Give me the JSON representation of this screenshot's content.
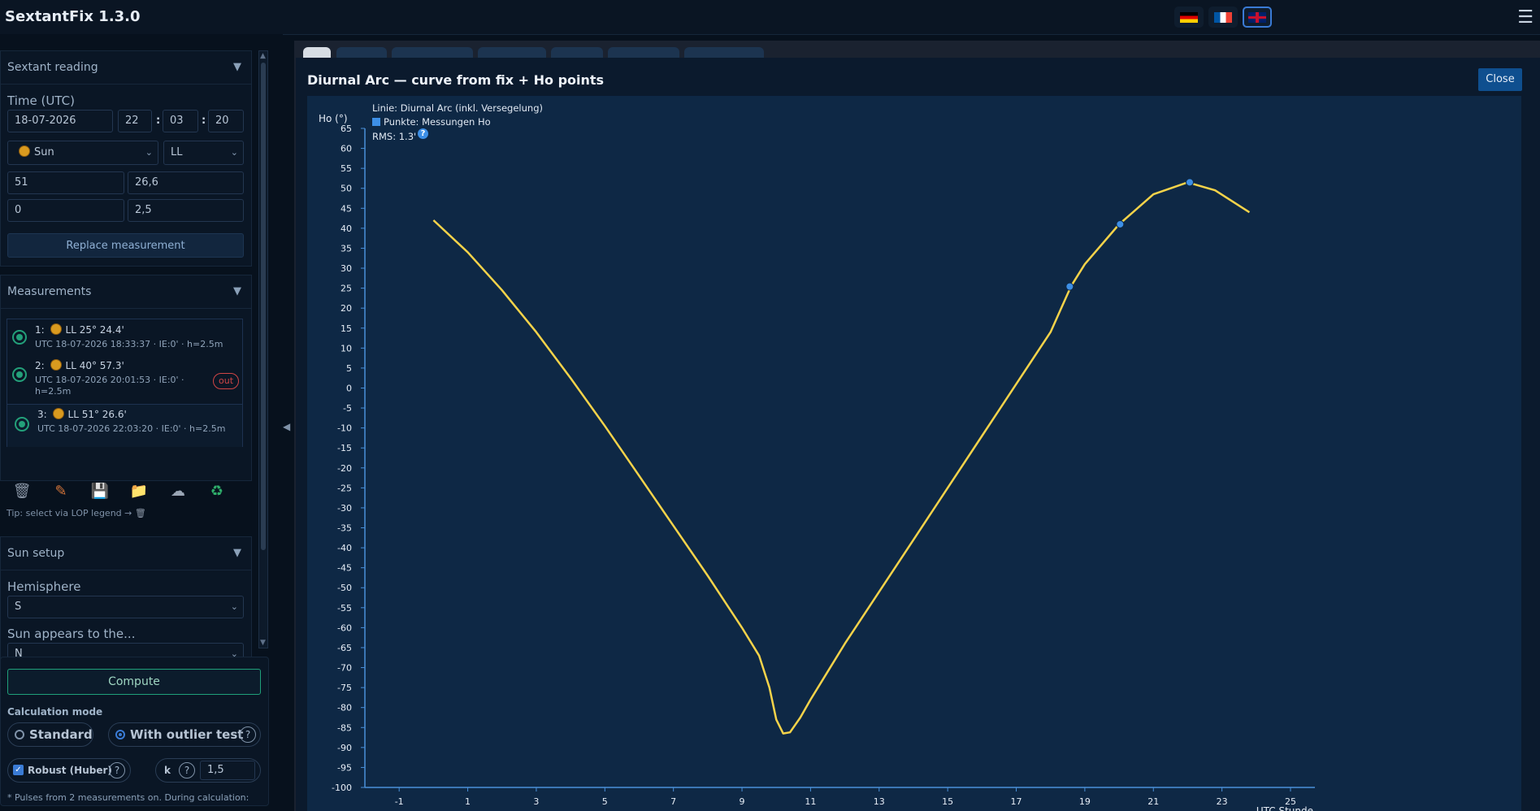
{
  "app": {
    "title": "SextantFix 1.3.0"
  },
  "languages": [
    "de",
    "fr",
    "en"
  ],
  "sextant": {
    "header": "Sextant reading",
    "time_label": "Time (UTC)",
    "date": "18-07-2026",
    "hh": "22",
    "mm": "03",
    "ss": "20",
    "body": "Sun",
    "limb": "LL",
    "deg": "51",
    "min": "26,6",
    "ie": "0",
    "height": "2,5",
    "replace_btn": "Replace measurement"
  },
  "measurements": {
    "header": "Measurements",
    "items": [
      {
        "num": "1:",
        "main": "LL 25° 24.4'",
        "sub": "UTC 18-07-2026 18:33:37 · IE:0' · h=2.5m"
      },
      {
        "num": "2:",
        "main": "LL 40° 57.3'",
        "sub1": "UTC 18-07-2026 20:01:53 · IE:0' ·",
        "sub2": "h=2.5m",
        "badge": "out"
      },
      {
        "num": "3:",
        "main": "LL 51° 26.6'",
        "sub": "UTC 18-07-2026 22:03:20 · IE:0' · h=2.5m"
      }
    ],
    "tip": "Tip: select via LOP legend →"
  },
  "sun_setup": {
    "header": "Sun setup",
    "hemisphere_label": "Hemisphere",
    "hemisphere": "S",
    "appears_label": "Sun appears to the...",
    "appears": "N"
  },
  "compute": {
    "button": "Compute",
    "mode_label": "Calculation mode",
    "standard": "Standard",
    "outlier": "With outlier test",
    "robust": "Robust (Huber)",
    "k_label": "k",
    "k_value": "1,5",
    "note": "* Pulses from 2 measurements on. During calculation:",
    "help": "?"
  },
  "modal": {
    "title": "Diurnal Arc — curve from fix + Ho points",
    "close": "Close"
  },
  "chart_data": {
    "type": "line",
    "ylabel": "Ho (°)",
    "xlabel": "UTC Stunde",
    "legend": {
      "line": "Linie: Diurnal Arc (inkl. Versegelung)",
      "points": "Punkte: Messungen Ho",
      "rms": "RMS: 1.3'"
    },
    "xlim": [
      -2,
      25
    ],
    "ylim": [
      -100,
      65
    ],
    "xticks": [
      -1,
      1,
      3,
      5,
      7,
      9,
      11,
      13,
      15,
      17,
      19,
      21,
      23,
      25
    ],
    "yticks": [
      65,
      60,
      55,
      50,
      45,
      40,
      35,
      30,
      25,
      20,
      15,
      10,
      5,
      0,
      -5,
      -10,
      -15,
      -20,
      -25,
      -30,
      -35,
      -40,
      -45,
      -50,
      -55,
      -60,
      -65,
      -70,
      -75,
      -80,
      -85,
      -90,
      -95,
      -100
    ],
    "series": [
      {
        "name": "Diurnal Arc",
        "color": "#f5d34a",
        "points": [
          [
            0.0,
            42.0
          ],
          [
            1.0,
            34.0
          ],
          [
            2.0,
            24.5
          ],
          [
            3.0,
            14.0
          ],
          [
            4.0,
            2.5
          ],
          [
            5.0,
            -9.5
          ],
          [
            6.0,
            -22.0
          ],
          [
            7.0,
            -34.5
          ],
          [
            8.0,
            -47.0
          ],
          [
            9.0,
            -60.0
          ],
          [
            9.5,
            -67.0
          ],
          [
            9.8,
            -75.0
          ],
          [
            10.0,
            -83.0
          ],
          [
            10.2,
            -86.5
          ],
          [
            10.4,
            -86.2
          ],
          [
            10.7,
            -82.5
          ],
          [
            11.0,
            -78.0
          ],
          [
            12.0,
            -64.0
          ],
          [
            13.0,
            -51.0
          ],
          [
            14.0,
            -38.0
          ],
          [
            15.0,
            -25.0
          ],
          [
            16.0,
            -12.0
          ],
          [
            17.0,
            1.0
          ],
          [
            18.0,
            14.0
          ],
          [
            18.6,
            25.5
          ],
          [
            19.0,
            31.0
          ],
          [
            20.0,
            41.0
          ],
          [
            21.0,
            48.5
          ],
          [
            22.0,
            51.5
          ],
          [
            22.8,
            49.5
          ],
          [
            23.8,
            44.0
          ]
        ]
      }
    ],
    "points": {
      "name": "Messungen Ho",
      "color": "#3d8fe6",
      "values": [
        [
          18.56,
          25.4
        ],
        [
          20.03,
          41.0
        ],
        [
          22.06,
          51.5
        ]
      ]
    }
  }
}
